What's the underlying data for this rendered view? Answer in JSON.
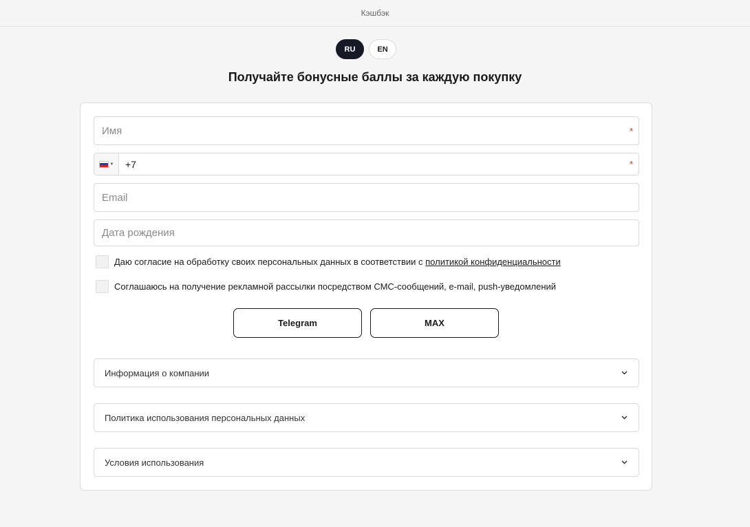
{
  "header": {
    "title": "Кэшбэк"
  },
  "lang": {
    "ru": "RU",
    "en": "EN"
  },
  "page": {
    "title": "Получайте бонусные баллы за каждую покупку"
  },
  "form": {
    "name_placeholder": "Имя",
    "phone_prefix": "+7",
    "email_placeholder": "Email",
    "birthdate_placeholder": "Дата рождения",
    "required_mark": "*",
    "consent1_text": "Даю согласие на обработку своих персональных данных в соответствии с ",
    "consent1_link": "политикой конфиденциальности",
    "consent2_text": "Соглашаюсь на получение рекламной рассылки посредством СМС-сообщений, e-mail, push-уведомлений",
    "telegram_label": "Telegram",
    "max_label": "MAX"
  },
  "accordions": [
    {
      "label": "Информация о компании"
    },
    {
      "label": "Политика использования персональных данных"
    },
    {
      "label": "Условия использования"
    }
  ],
  "icons": {
    "flag": "russia-flag-icon",
    "chevron": "chevron-down-icon"
  },
  "colors": {
    "accent": "#151a26",
    "required": "#c0392b",
    "background": "#f5f5f5"
  }
}
